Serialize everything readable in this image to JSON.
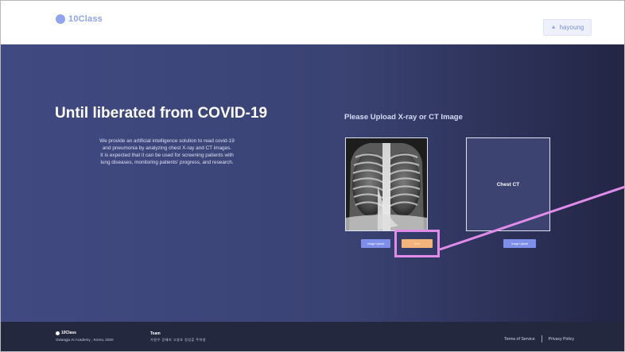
{
  "header": {
    "logo_text": "10Class",
    "user_icon": "person-icon",
    "user_name": "hayoung"
  },
  "hero": {
    "title": "Until liberated from COVID-19",
    "description": [
      "We provide an artificial intelligence solution to read covid-19",
      "and pneumonia by analyzing chest X-ray and CT images.",
      "It is expected that it can be used for screening patients with",
      "lung diseases, monitoring patients' progress, and research."
    ]
  },
  "upload": {
    "prompt": "Please Upload X-ray or CT Image",
    "xray_panel": {
      "image": "chest-xray-image"
    },
    "ct_panel": {
      "label": "Chest CT"
    },
    "xray_upload_label": "Image Upload",
    "start_label": "Start",
    "ct_upload_label": "Image Upload"
  },
  "footer": {
    "brand": "10Class",
    "org": "Gwangju AI Academy , Korea, 2020",
    "team_title": "Team",
    "team_members": "가원우  강혜지  고영호  정성훈  주하영",
    "terms": "Terms of Service",
    "privacy": "Privacy Policy"
  },
  "colors": {
    "accent": "#8fa3ee",
    "hero_bg": "#3a4373",
    "start_button": "#f3b47b",
    "upload_button": "#7d8fe8",
    "highlight": "#e08ce8",
    "footer_bg": "#24283f"
  }
}
